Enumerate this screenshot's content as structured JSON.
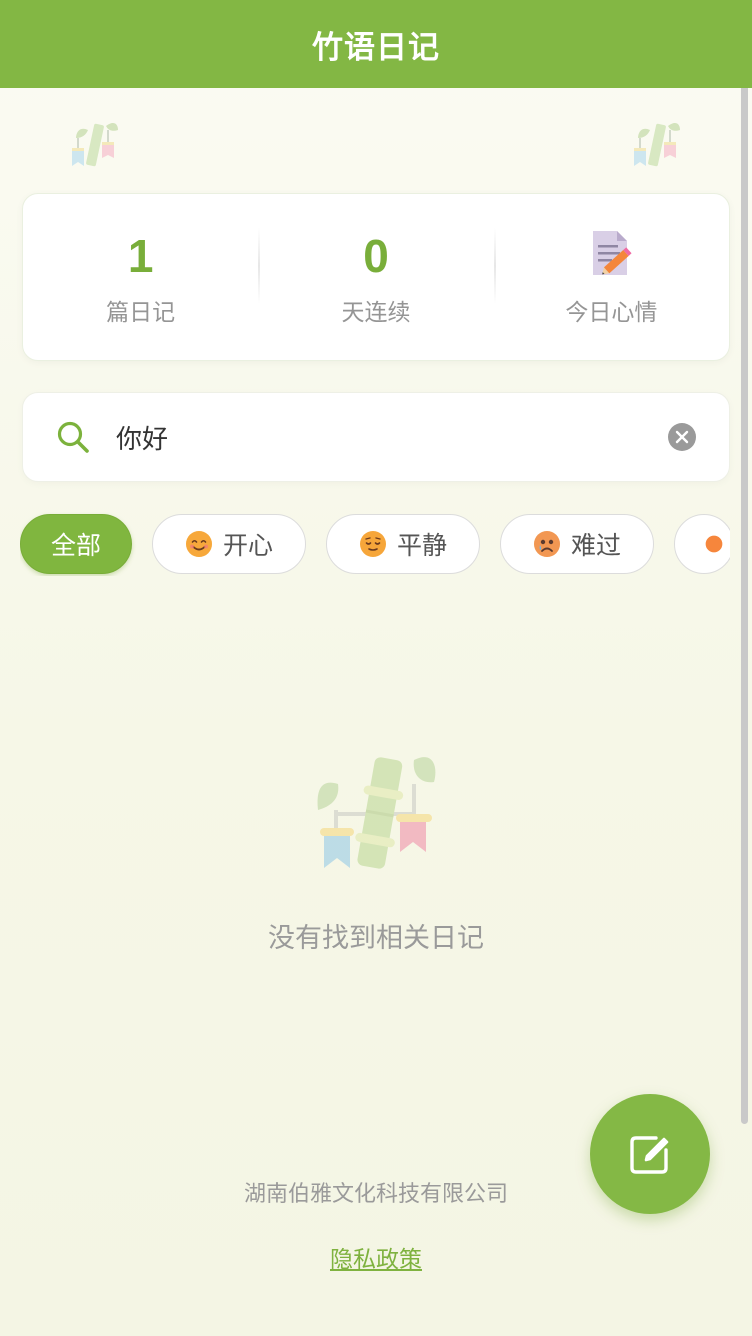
{
  "header": {
    "title": "竹语日记"
  },
  "stats": {
    "entries": {
      "value": "1",
      "label": "篇日记"
    },
    "streak": {
      "value": "0",
      "label": "天连续"
    },
    "mood": {
      "icon": "memo-pencil-icon",
      "label": "今日心情"
    }
  },
  "search": {
    "value": "你好",
    "placeholder": ""
  },
  "filters": [
    {
      "label": "全部",
      "active": true
    },
    {
      "label": "开心",
      "emoji": "smiling-face-icon"
    },
    {
      "label": "平静",
      "emoji": "relieved-face-icon"
    },
    {
      "label": "难过",
      "emoji": "sad-face-icon"
    }
  ],
  "empty": {
    "text": "没有找到相关日记"
  },
  "footer": {
    "company": "湖南伯雅文化科技有限公司",
    "privacy": "隐私政策"
  },
  "colors": {
    "brand": "#83b744",
    "accent_text": "#79ae3a"
  }
}
